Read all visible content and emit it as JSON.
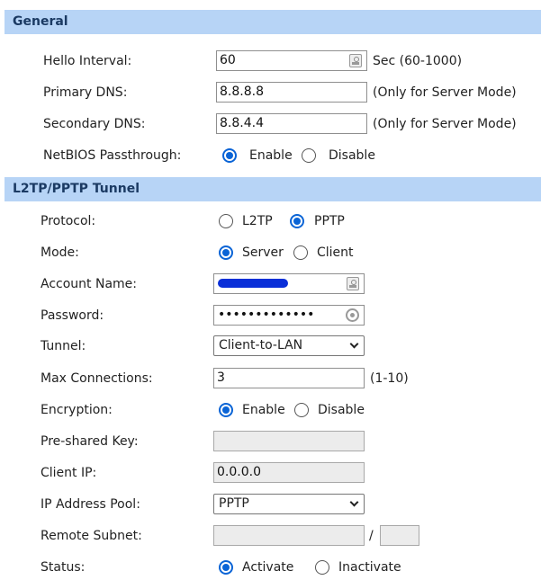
{
  "general": {
    "header": "General",
    "hello_interval": {
      "label": "Hello Interval:",
      "value": "60",
      "note": "Sec (60-1000)"
    },
    "primary_dns": {
      "label": "Primary DNS:",
      "value": "8.8.8.8",
      "note": "(Only for Server Mode)"
    },
    "secondary_dns": {
      "label": "Secondary DNS:",
      "value": "8.8.4.4",
      "note": "(Only for Server Mode)"
    },
    "netbios": {
      "label": "NetBIOS Passthrough:",
      "enable": "Enable",
      "disable": "Disable",
      "selected": "Enable"
    }
  },
  "tunnel": {
    "header": "L2TP/PPTP Tunnel",
    "protocol": {
      "label": "Protocol:",
      "l2tp": "L2TP",
      "pptp": "PPTP",
      "selected": "PPTP"
    },
    "mode": {
      "label": "Mode:",
      "server": "Server",
      "client": "Client",
      "selected": "Server"
    },
    "account_name": {
      "label": "Account Name:"
    },
    "password": {
      "label": "Password:",
      "masked_value": "•••••••••••••"
    },
    "tunnel": {
      "label": "Tunnel:",
      "selected": "Client-to-LAN"
    },
    "max_connections": {
      "label": "Max Connections:",
      "value": "3",
      "note": "(1-10)"
    },
    "encryption": {
      "label": "Encryption:",
      "enable": "Enable",
      "disable": "Disable",
      "selected": "Enable"
    },
    "preshared_key": {
      "label": "Pre-shared Key:",
      "value": ""
    },
    "client_ip": {
      "label": "Client IP:",
      "value": "0.0.0.0"
    },
    "ip_pool": {
      "label": "IP Address Pool:",
      "selected": "PPTP"
    },
    "remote_subnet": {
      "label": "Remote Subnet:",
      "separator": "/",
      "value": "",
      "mask": ""
    },
    "status": {
      "label": "Status:",
      "activate": "Activate",
      "inactivate": "Inactivate",
      "selected": "Activate"
    }
  },
  "colors": {
    "header_bg": "#b7d4f6",
    "header_text": "#1b3a63",
    "accent": "#0a64d6",
    "redaction": "#0a2fd8"
  }
}
